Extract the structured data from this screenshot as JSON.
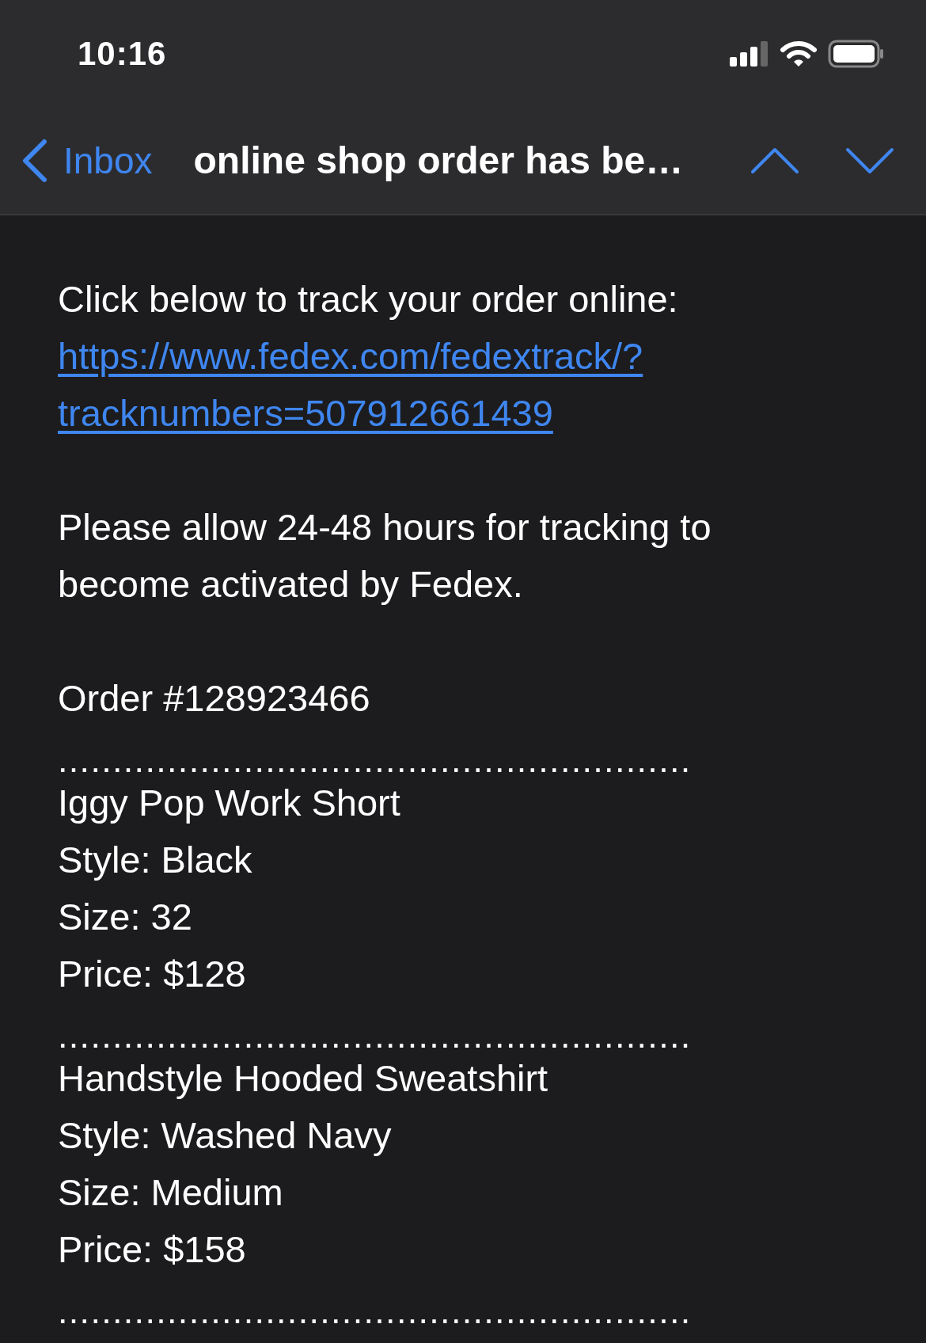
{
  "status_bar": {
    "time": "10:16"
  },
  "nav": {
    "back_label": "Inbox",
    "title": "online shop order has be…"
  },
  "body": [
    {
      "kind": "text",
      "text": "Click below to track your order online:"
    },
    {
      "kind": "link",
      "lines": [
        "https://www.fedex.com/fedextrack/?",
        "tracknumbers=507912661439"
      ]
    },
    {
      "kind": "blank"
    },
    {
      "kind": "text",
      "text": "Please allow 24-48 hours for tracking to become activated by Fedex."
    },
    {
      "kind": "blank"
    },
    {
      "kind": "text",
      "text": "Order #128923466"
    },
    {
      "kind": "dots",
      "text": ".........................................................."
    },
    {
      "kind": "text",
      "text": "Iggy Pop Work Short"
    },
    {
      "kind": "text",
      "text": "Style: Black"
    },
    {
      "kind": "text",
      "text": "Size: 32"
    },
    {
      "kind": "text",
      "text": "Price: $128"
    },
    {
      "kind": "dots",
      "text": ".........................................................."
    },
    {
      "kind": "text",
      "text": "Handstyle Hooded Sweatshirt"
    },
    {
      "kind": "text",
      "text": "Style: Washed Navy"
    },
    {
      "kind": "text",
      "text": "Size: Medium"
    },
    {
      "kind": "text",
      "text": "Price: $158"
    },
    {
      "kind": "dots",
      "text": ".........................................................."
    }
  ]
}
